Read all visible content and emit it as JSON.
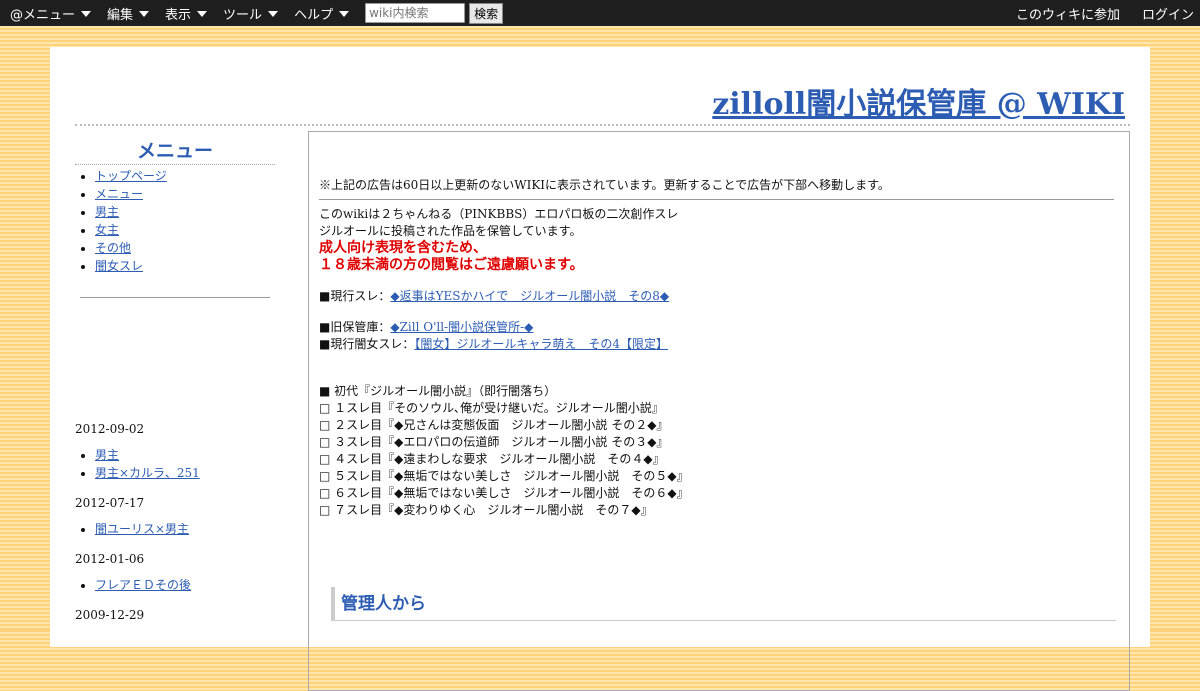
{
  "topbar": {
    "menus": [
      "@メニュー",
      "編集",
      "表示",
      "ツール",
      "ヘルプ"
    ],
    "search_placeholder": "wiki内検索",
    "search_button": "検索",
    "join": "このウィキに参加",
    "login": "ログイン"
  },
  "site": {
    "title": "zilloll闇小説保管庫 @ WIKI"
  },
  "sidebar": {
    "heading": "メニュー",
    "items": [
      "トップページ",
      "メニュー",
      "男主",
      "女主",
      "その他",
      "闇女スレ"
    ],
    "updates": [
      {
        "date": "2012-09-02",
        "links": [
          "男主",
          "男主×カルラ、251"
        ]
      },
      {
        "date": "2012-07-17",
        "links": [
          "闇ユーリス×男主"
        ]
      },
      {
        "date": "2012-01-06",
        "links": [
          "フレアＥＤその後"
        ]
      },
      {
        "date": "2009-12-29",
        "links": []
      }
    ]
  },
  "main": {
    "ad_note": "※上記の広告は60日以上更新のないWIKIに表示されています。更新することで広告が下部へ移動します。",
    "intro1": "このwikiは２ちゃんねる（PINKBBS）エロパロ板の二次創作スレ",
    "intro2": "ジルオールに投稿された作品を保管しています。",
    "warn1": "成人向け表現を含むため、",
    "warn2": "１８歳未満の方の閲覧はご遠慮願います。",
    "current_prefix": "■現行スレ：",
    "current_link": "◆返事はYESかハイで　ジルオール闇小説　その8◆",
    "old_prefix": "■旧保管庫：",
    "old_link": "◆Zill O'll-闇小説保管所-◆",
    "yamijo_prefix": "■現行闇女スレ：",
    "yamijo_link": "【闇女】ジルオールキャラ萌え　その4【限定】",
    "history": [
      "■ 初代『ジルオール闇小説』（即行闇落ち）",
      "□ １スレ目『そのソウル､俺が受け継いだ。ジルオール闇小説』",
      "□ ２スレ目『◆兄さんは変態仮面　ジルオール闇小説 その２◆』",
      "□ ３スレ目『◆エロパロの伝道師　ジルオール闇小説 その３◆』",
      "□ ４スレ目『◆遠まわしな要求　ジルオール闇小説　その４◆』",
      "□ ５スレ目『◆無垢ではない美しさ　ジルオール闇小説　その５◆』",
      "□ ６スレ目『◆無垢ではない美しさ　ジルオール闇小説　その６◆』",
      "□ ７スレ目『◆変わりゆく心　ジルオール闇小説　その７◆』"
    ],
    "admin_heading": "管理人から"
  }
}
